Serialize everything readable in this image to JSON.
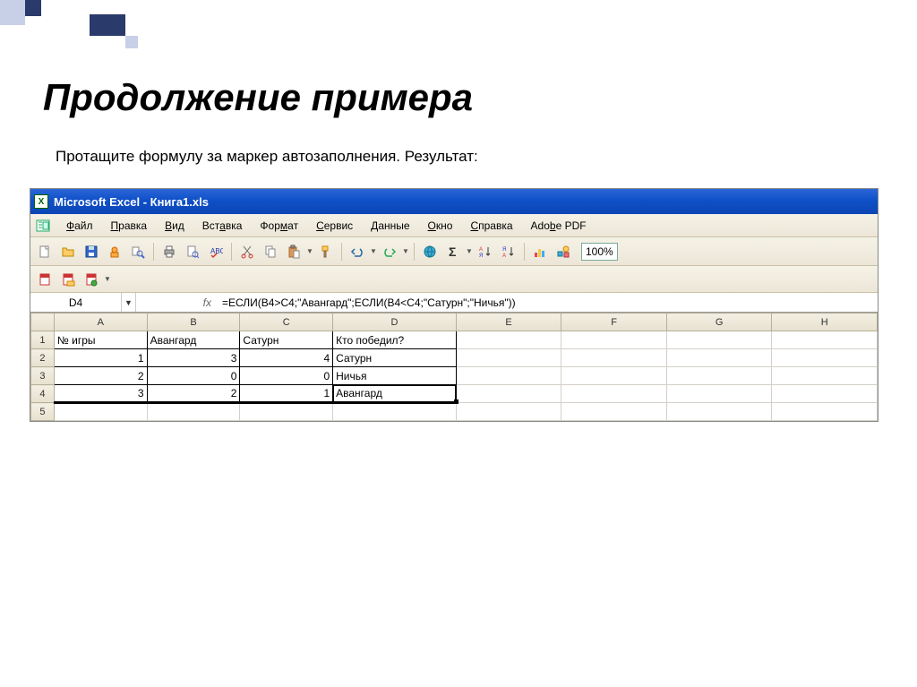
{
  "slide": {
    "title": "Продолжение примера",
    "subtitle": "Протащите формулу за маркер автозаполнения. Результат:"
  },
  "titlebar": {
    "text": "Microsoft Excel - Книга1.xls",
    "icon_letter": "X"
  },
  "menu": {
    "items": [
      {
        "label": "Файл",
        "u": 0
      },
      {
        "label": "Правка",
        "u": 0
      },
      {
        "label": "Вид",
        "u": 0
      },
      {
        "label": "Вставка",
        "u": 3
      },
      {
        "label": "Формат",
        "u": 3
      },
      {
        "label": "Сервис",
        "u": 0
      },
      {
        "label": "Данные",
        "u": 0
      },
      {
        "label": "Окно",
        "u": 0
      },
      {
        "label": "Справка",
        "u": 0
      },
      {
        "label": "Adobe PDF",
        "u": 3
      }
    ]
  },
  "zoom": "100%",
  "formula": {
    "name_box": "D4",
    "fx": "fx",
    "text": "=ЕСЛИ(B4>C4;\"Авангард\";ЕСЛИ(B4<C4;\"Сатурн\";\"Ничья\"))"
  },
  "columns": [
    "A",
    "B",
    "C",
    "D",
    "E",
    "F",
    "G",
    "H"
  ],
  "rows": [
    {
      "n": 1,
      "A": "№ игры",
      "B": "Авангард",
      "C": "Сатурн",
      "D": "Кто победил?"
    },
    {
      "n": 2,
      "A": "1",
      "B": "3",
      "C": "4",
      "D": "Сатурн"
    },
    {
      "n": 3,
      "A": "2",
      "B": "0",
      "C": "0",
      "D": "Ничья"
    },
    {
      "n": 4,
      "A": "3",
      "B": "2",
      "C": "1",
      "D": "Авангард"
    },
    {
      "n": 5,
      "A": "",
      "B": "",
      "C": "",
      "D": ""
    }
  ]
}
